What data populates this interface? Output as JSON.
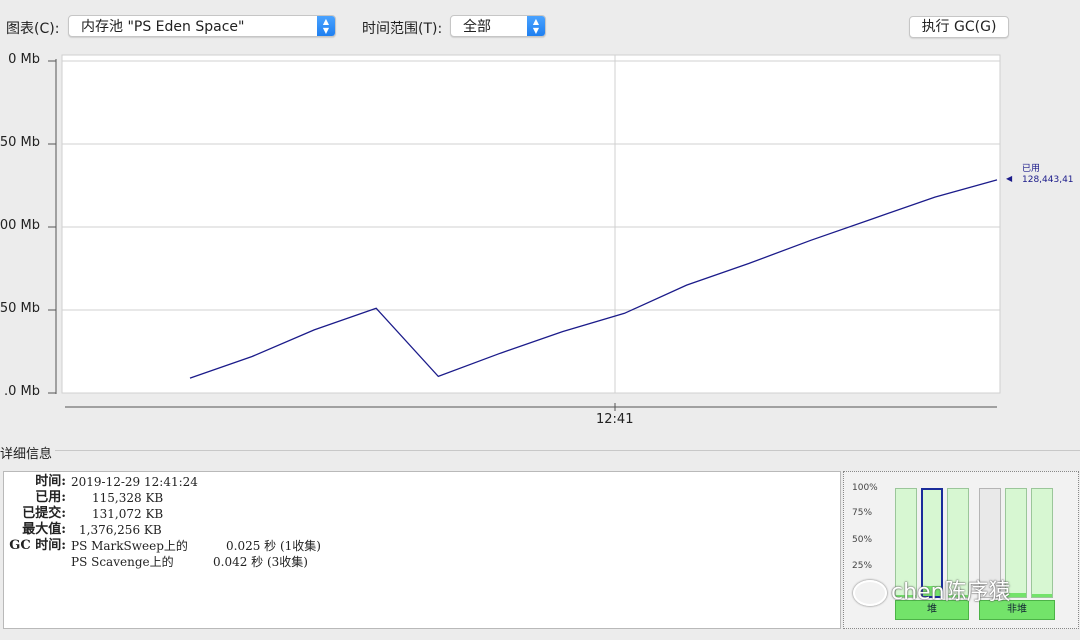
{
  "toolbar": {
    "chart_label": "图表(C):",
    "chart_select_value": "内存池 \"PS Eden Space\"",
    "time_range_label": "时间范围(T):",
    "time_range_value": "全部",
    "gc_button_label": "执行 GC(G)"
  },
  "chart_data": {
    "type": "line",
    "yticks": [
      "0 Mb",
      "50 Mb",
      "00 Mb",
      "50 Mb",
      ".0 Mb"
    ],
    "ytick_values": [
      200,
      150,
      100,
      50,
      0
    ],
    "ylim": [
      0,
      200
    ],
    "xticks": [
      "12:41"
    ],
    "series": [
      {
        "name": "已用",
        "values": [
          9,
          22,
          38,
          51,
          10,
          24,
          37,
          48,
          65,
          78,
          92,
          105,
          118,
          128.4
        ]
      }
    ],
    "current_label": "已用",
    "current_value": "128,443,41",
    "grid": true
  },
  "details": {
    "title": "详细信息",
    "time_label": "时间:",
    "time_value": "2019-12-29 12:41:24",
    "used_label": "已用:",
    "used_value": "115,328 KB",
    "committed_label": "已提交:",
    "committed_value": "131,072 KB",
    "max_label": "最大值:",
    "max_value": "1,376,256 KB",
    "gc_label": "GC 时间:",
    "gc_rows": [
      {
        "name": "PS MarkSweep上的",
        "value": "0.025 秒 (1收集)"
      },
      {
        "name": "PS Scavenge上的",
        "value": "0.042 秒 (3收集)"
      }
    ]
  },
  "memory_bars": {
    "percent_labels": [
      "100%",
      "75%",
      "50%",
      "25%"
    ],
    "heap_label": "堆",
    "nonheap_label": "非堆",
    "heap_fills": [
      0.02,
      0.09,
      0.02
    ],
    "nonheap_fills": [
      0.0,
      0.04,
      0.03
    ],
    "fill_color": "#73e36a",
    "selected_color": "#1a2c9a"
  },
  "watermark": {
    "text": "chen陈序猿"
  },
  "colors": {
    "line": "#1b1b8a",
    "grid": "#d0d0d0"
  }
}
